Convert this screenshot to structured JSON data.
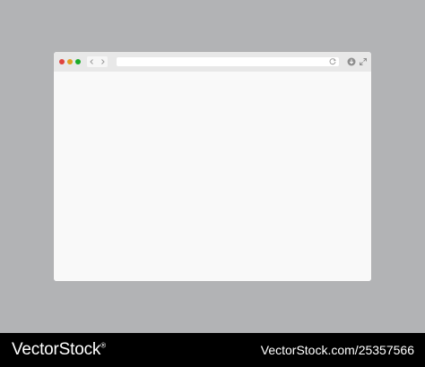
{
  "window": {
    "controls": {
      "close_color": "#e0443e",
      "minimize_color": "#dea123",
      "maximize_color": "#1aab29"
    },
    "toolbar": {
      "back_icon": "chevron-left-icon",
      "forward_icon": "chevron-right-icon",
      "reload_icon": "reload-icon",
      "download_icon": "download-icon",
      "expand_icon": "expand-icon"
    },
    "address_bar": {
      "value": "",
      "placeholder": ""
    }
  },
  "footer": {
    "brand_left": "VectorStock",
    "registered_mark": "®",
    "brand_right": "VectorStock.com/25357566"
  }
}
